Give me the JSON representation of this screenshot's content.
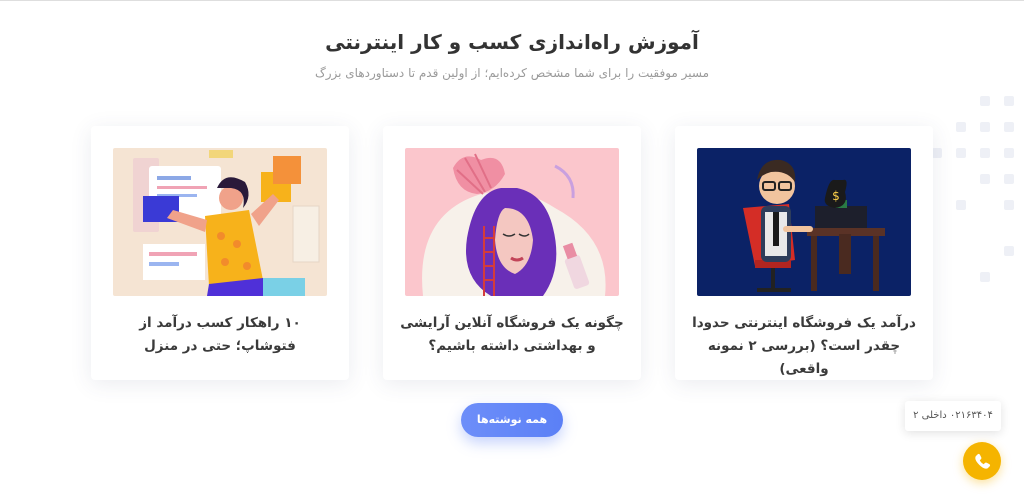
{
  "section": {
    "title": "آموزش راه‌اندازی کسب و کار اینترنتی",
    "subtitle": "مسیر موفقیت را برای شما مشخص کرده‌ایم؛ از اولین قدم تا دستاوردهای بزرگ"
  },
  "cards": [
    {
      "title": "درآمد یک فروشگاه اینترنتی حدودا چقدر است؟ (بررسی ۲ نمونه واقعی)",
      "image_icon": "office-man-money-illustration"
    },
    {
      "title": "چگونه یک فروشگاه آنلاین آرایشی و بهداشتی داشته باشیم؟",
      "image_icon": "woman-makeup-illustration"
    },
    {
      "title": "۱۰ راهکار کسب درآمد از فتوشاپ؛ حتی در منزل",
      "image_icon": "designer-woman-illustration"
    }
  ],
  "all_posts_label": "همه نوشته‌ها",
  "contact": {
    "phone_text": "۰۲۱۶۳۴۰۴ داخلی ۲",
    "icon": "phone-icon"
  },
  "colors": {
    "accent_blue": "#5b80f6",
    "call_yellow": "#f5b400",
    "card1_bg": "#0b2266",
    "card2_bg": "#fbc6cc",
    "card3_bg": "#f5e4d3"
  }
}
